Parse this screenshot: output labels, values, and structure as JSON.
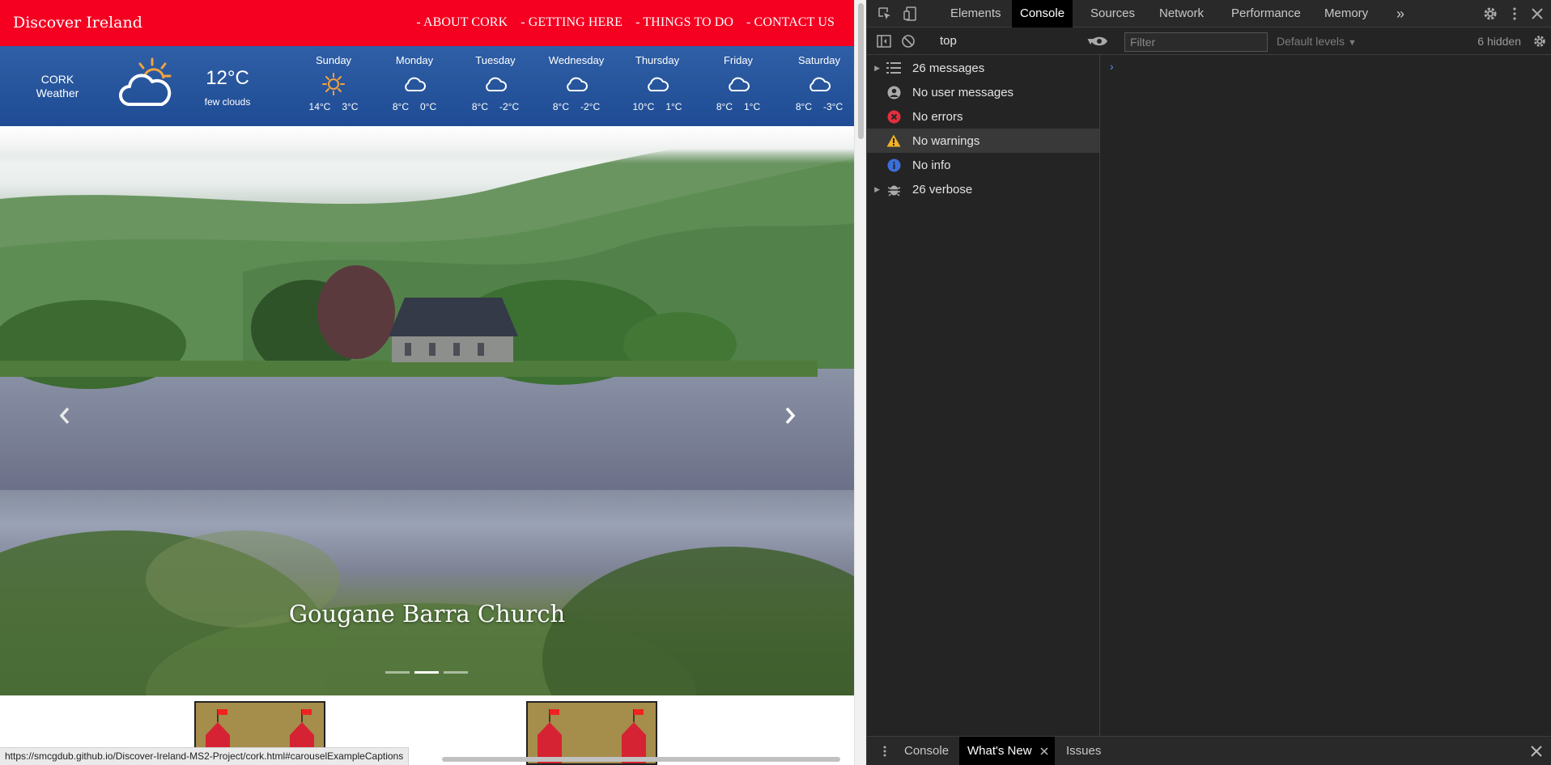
{
  "site": {
    "brand": "Discover Ireland",
    "nav": [
      "- ABOUT CORK",
      "- GETTING HERE",
      "- THINGS TO DO",
      "- CONTACT US"
    ],
    "weather": {
      "city": "CORK",
      "city_sub": "Weather",
      "icon": "partly-cloudy-icon",
      "temp": "12°C",
      "desc": "few clouds",
      "forecast": [
        {
          "day": "Sunday",
          "icon": "sun-icon",
          "high": "14°C",
          "low": "3°C"
        },
        {
          "day": "Monday",
          "icon": "cloud-icon",
          "high": "8°C",
          "low": "0°C"
        },
        {
          "day": "Tuesday",
          "icon": "cloud-icon",
          "high": "8°C",
          "low": "-2°C"
        },
        {
          "day": "Wednesday",
          "icon": "cloud-icon",
          "high": "8°C",
          "low": "-2°C"
        },
        {
          "day": "Thursday",
          "icon": "cloud-icon",
          "high": "10°C",
          "low": "1°C"
        },
        {
          "day": "Friday",
          "icon": "cloud-icon",
          "high": "8°C",
          "low": "1°C"
        },
        {
          "day": "Saturday",
          "icon": "cloud-icon",
          "high": "8°C",
          "low": "-3°C"
        }
      ]
    },
    "carousel": {
      "caption": "Gougane Barra Church",
      "slides": 3,
      "active_slide": 2
    },
    "status_url": "https://smcgdub.github.io/Discover-Ireland-MS2-Project/cork.html#carouselExampleCaptions"
  },
  "devtools": {
    "tabs": [
      "Elements",
      "Console",
      "Sources",
      "Network",
      "Performance",
      "Memory"
    ],
    "active_tab": "Console",
    "more_tabs": "»",
    "context": "top",
    "filter_placeholder": "Filter",
    "levels": "Default levels",
    "hidden": "6 hidden",
    "sidebar": [
      {
        "label": "26 messages",
        "icon": "list-icon",
        "expandable": true
      },
      {
        "label": "No user messages",
        "icon": "user-icon",
        "expandable": false
      },
      {
        "label": "No errors",
        "icon": "error-icon",
        "expandable": false
      },
      {
        "label": "No warnings",
        "icon": "warning-icon",
        "expandable": false,
        "selected": true
      },
      {
        "label": "No info",
        "icon": "info-icon",
        "expandable": false
      },
      {
        "label": "26 verbose",
        "icon": "bug-icon",
        "expandable": true
      }
    ],
    "prompt": "›",
    "drawer_tabs": [
      "Console",
      "What's New",
      "Issues"
    ],
    "drawer_active": "What's New"
  },
  "colors": {
    "navbar": "#f50021",
    "weather_bar": "#2f5fa6",
    "devtools_bg": "#242424",
    "error": "#e52e3d",
    "warning": "#f2b224",
    "info": "#3b6fd8"
  }
}
